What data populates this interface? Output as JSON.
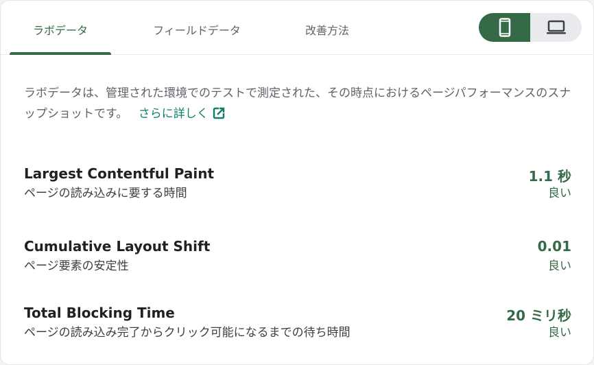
{
  "tabs": [
    {
      "label": "ラボデータ",
      "active": true
    },
    {
      "label": "フィールドデータ",
      "active": false
    },
    {
      "label": "改善方法",
      "active": false
    }
  ],
  "device_toggle": {
    "selected": "mobile",
    "mobile_icon": "smartphone-icon",
    "desktop_icon": "laptop-icon"
  },
  "intro": {
    "text": "ラボデータは、管理された環境でのテストで測定された、その時点におけるページパフォーマンスのスナップショットです。",
    "link_label": "さらに詳しく",
    "link_icon": "external-link-icon"
  },
  "metrics": [
    {
      "name": "Largest Contentful Paint",
      "description": "ページの読み込みに要する時間",
      "value": "1.1 秒",
      "rating": "良い"
    },
    {
      "name": "Cumulative Layout Shift",
      "description": "ページ要素の安定性",
      "value": "0.01",
      "rating": "良い"
    },
    {
      "name": "Total Blocking Time",
      "description": "ページの読み込み完了からクリック可能になるまでの待ち時間",
      "value": "20 ミリ秒",
      "rating": "良い"
    }
  ],
  "colors": {
    "accent": "#356a47",
    "link": "#127f6b",
    "muted_text": "#5f6368"
  }
}
